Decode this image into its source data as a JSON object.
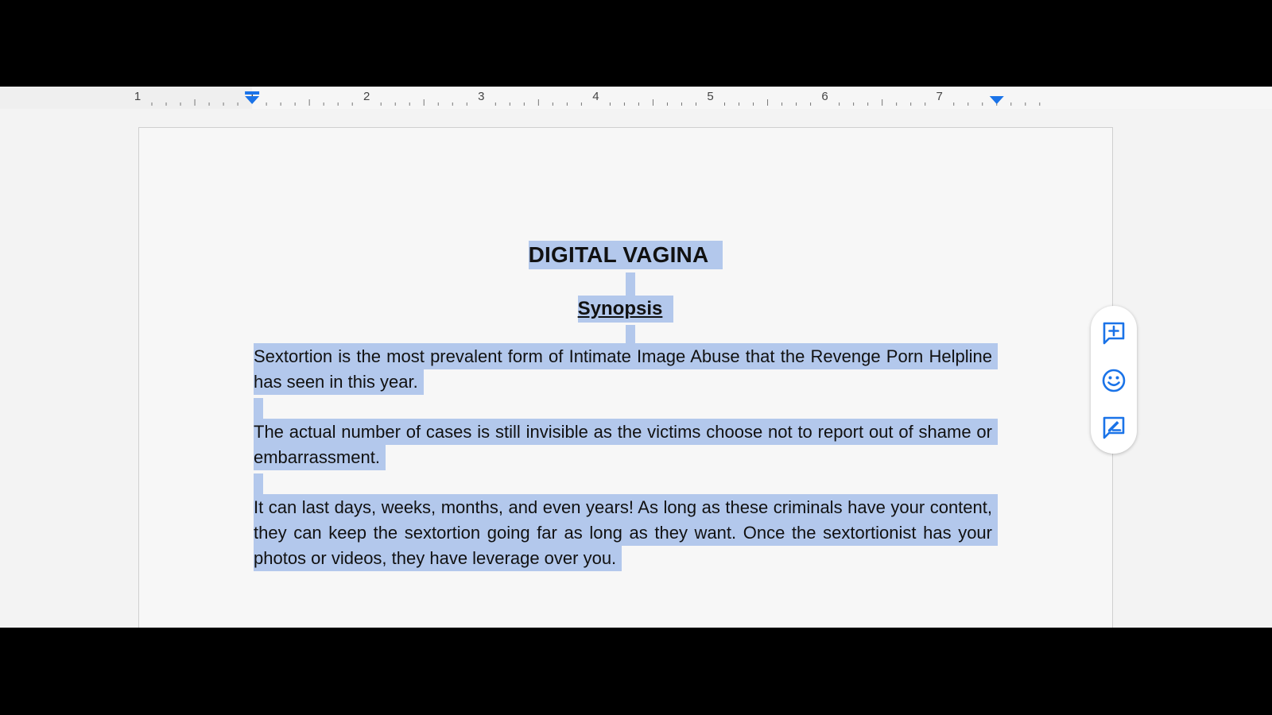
{
  "ruler": {
    "numbers": [
      "1",
      "1",
      "2",
      "3",
      "4",
      "5",
      "6",
      "7"
    ]
  },
  "document": {
    "title": "DIGITAL VAGINA",
    "subtitle": "Synopsis",
    "paragraphs": [
      "Sextortion is the most prevalent form of Intimate Image Abuse that the Revenge Porn Helpline has seen in this year.",
      "The actual number of cases is still invisible as the victims choose not to report out of shame or embarrassment.",
      "It can last days, weeks, months, and even years! As long as these criminals have your content, they can keep the sextortion going far as long as they want. Once the sextortionist has your photos or videos, they have leverage over you."
    ]
  },
  "floating_toolbar": {
    "buttons": [
      {
        "icon": "add-comment-icon"
      },
      {
        "icon": "emoji-reaction-icon"
      },
      {
        "icon": "suggest-edit-icon"
      }
    ]
  },
  "colors": {
    "selection": "#b3c8ec",
    "accent": "#1a73e8"
  }
}
